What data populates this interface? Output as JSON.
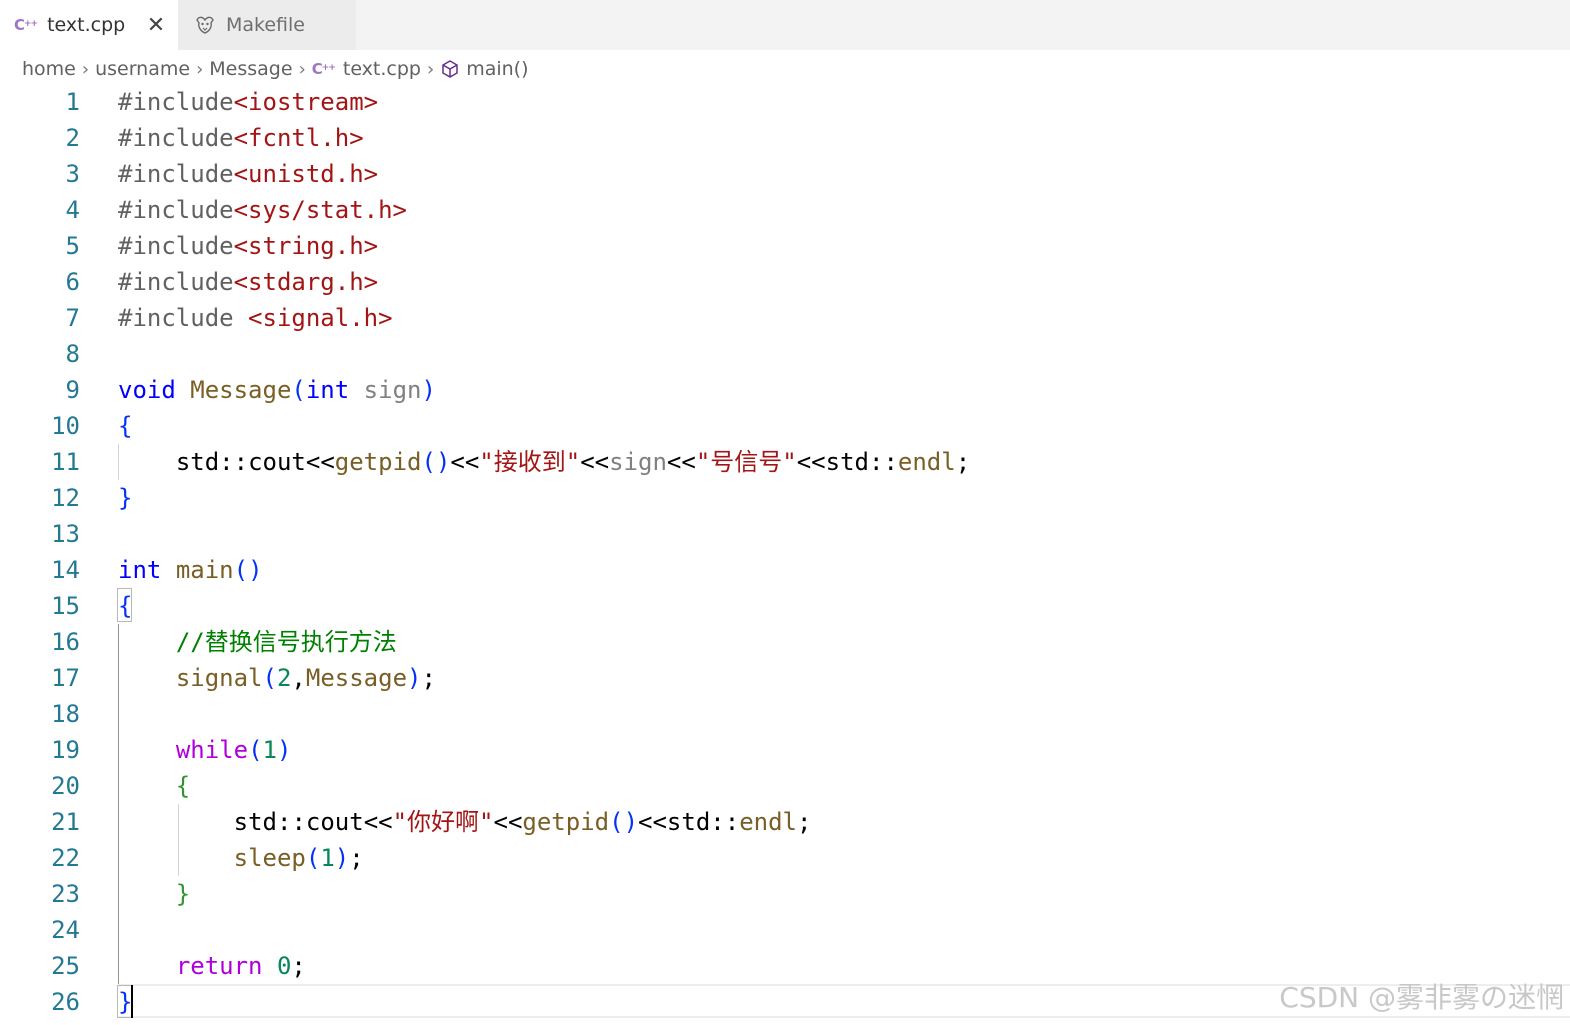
{
  "tabs": [
    {
      "label": "text.cpp",
      "icon": "cpp-icon",
      "active": true,
      "close": "✕"
    },
    {
      "label": "Makefile",
      "icon": "makefile-gnu-icon",
      "active": false
    }
  ],
  "breadcrumb": {
    "items": [
      "home",
      "username",
      "Message",
      "text.cpp",
      "main()"
    ],
    "separator": "›"
  },
  "editor": {
    "language": "cpp",
    "lines": [
      "#include<iostream>",
      "#include<fcntl.h>",
      "#include<unistd.h>",
      "#include<sys/stat.h>",
      "#include<string.h>",
      "#include<stdarg.h>",
      "#include <signal.h>",
      "",
      "void Message(int sign)",
      "{",
      "    std::cout<<getpid()<<\"接收到\"<<sign<<\"号信号\"<<std::endl;",
      "}",
      "",
      "int main()",
      "{",
      "    //替换信号执行方法",
      "    signal(2,Message);",
      "",
      "    while(1)",
      "    {",
      "        std::cout<<\"你好啊\"<<getpid()<<std::endl;",
      "        sleep(1);",
      "    }",
      "",
      "    return 0;",
      "}"
    ],
    "cursor_line": 26
  },
  "watermark": "CSDN @雾非雾の迷惘",
  "colors": {
    "line_number": "#237893",
    "keyword": "#0000ff",
    "control_keyword": "#af00db",
    "function": "#795e26",
    "string": "#a31515",
    "comment": "#008000",
    "number": "#098658",
    "cpp_icon": "#a074c4"
  }
}
